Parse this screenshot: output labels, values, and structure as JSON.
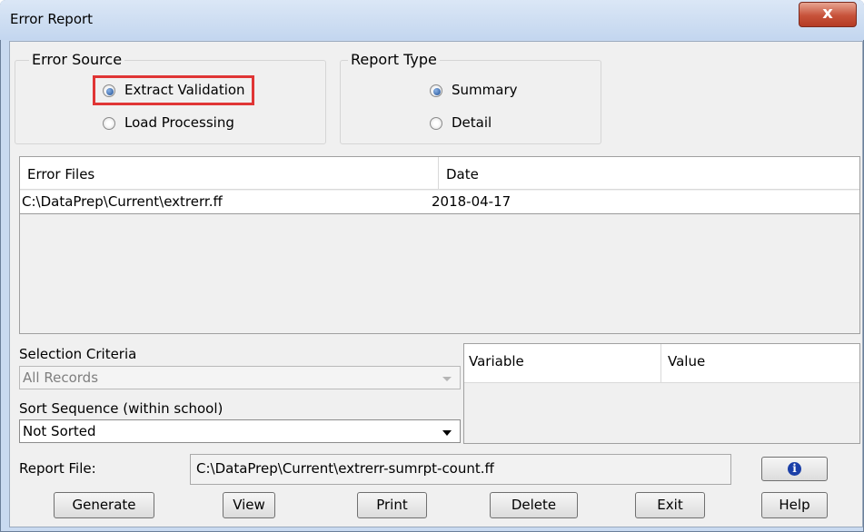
{
  "window": {
    "title": "Error Report",
    "close_glyph": "x"
  },
  "error_source": {
    "legend": "Error Source",
    "options": [
      {
        "label": "Extract Validation",
        "selected": true
      },
      {
        "label": "Load Processing",
        "selected": false
      }
    ]
  },
  "report_type": {
    "legend": "Report Type",
    "options": [
      {
        "label": "Summary",
        "selected": true
      },
      {
        "label": "Detail",
        "selected": false
      }
    ]
  },
  "error_files": {
    "columns": [
      "Error Files",
      "Date"
    ],
    "rows": [
      {
        "file": "C:\\DataPrep\\Current\\extrerr.ff",
        "date": "2018-04-17"
      }
    ]
  },
  "selection_criteria": {
    "label": "Selection Criteria",
    "value": "All Records"
  },
  "sort_sequence": {
    "label": "Sort Sequence (within school)",
    "value": "Not Sorted"
  },
  "variables_table": {
    "columns": [
      "Variable",
      "Value"
    ]
  },
  "report_file": {
    "label": "Report File:",
    "value": "C:\\DataPrep\\Current\\extrerr-sumrpt-count.ff",
    "info_glyph": "i"
  },
  "buttons": {
    "generate": "Generate",
    "view": "View",
    "print": "Print",
    "delete": "Delete",
    "exit": "Exit",
    "help": "Help"
  },
  "colors": {
    "highlight": "#e03535",
    "selected_radio": "#1f4f94",
    "info_icon": "#1b3fa8"
  }
}
